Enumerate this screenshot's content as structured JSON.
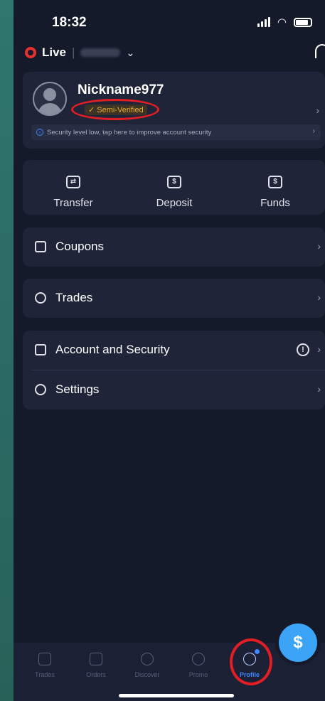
{
  "status_bar": {
    "time": "18:32"
  },
  "account": {
    "mode_label": "Live",
    "separator": "|"
  },
  "profile": {
    "nickname": "Nickname977",
    "verification_badge": "✓ Semi-Verified",
    "security_notice": "Security level low, tap here to improve account security"
  },
  "actions": [
    {
      "label": "Transfer",
      "icon": "transfer-icon"
    },
    {
      "label": "Deposit",
      "icon": "deposit-icon"
    },
    {
      "label": "Funds",
      "icon": "funds-icon"
    }
  ],
  "menu": {
    "coupons": "Coupons",
    "trades": "Trades",
    "account_security": "Account and Security",
    "settings": "Settings"
  },
  "tabs": [
    {
      "label": "Trades",
      "icon": "chart-icon"
    },
    {
      "label": "Orders",
      "icon": "list-icon"
    },
    {
      "label": "Discover",
      "icon": "planet-icon"
    },
    {
      "label": "Promo",
      "icon": "percent-icon"
    },
    {
      "label": "Profile",
      "icon": "profile-icon",
      "active": true
    }
  ],
  "fab": {
    "symbol": "$"
  },
  "colors": {
    "background": "#151a2b",
    "card": "#1f2438",
    "accent": "#3d86ff",
    "badge": "#f0b02c",
    "annotation": "#e11e24",
    "live_dot": "#e5322f"
  }
}
